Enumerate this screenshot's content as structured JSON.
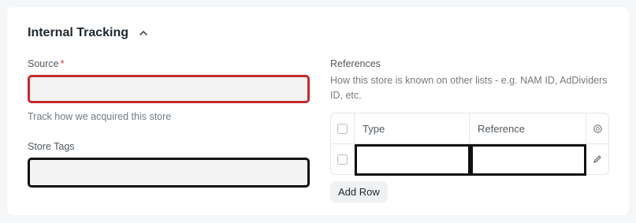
{
  "section": {
    "title": "Internal Tracking"
  },
  "source": {
    "label": "Source",
    "required_mark": "*",
    "value": "",
    "help": "Track how we acquired this store"
  },
  "store_tags": {
    "label": "Store Tags",
    "value": ""
  },
  "references": {
    "label": "References",
    "help": "How this store is known on other lists - e.g. NAM ID, AdDividers ID, etc.",
    "columns": [
      "Type",
      "Reference"
    ],
    "rows": [
      {
        "type": "",
        "reference": ""
      }
    ],
    "add_row_label": "Add Row"
  },
  "icons": {
    "collapse": "chevron-up-icon",
    "settings": "gear-icon",
    "edit": "pencil-icon"
  },
  "colors": {
    "required": "#e03131",
    "source_outline": "#c62b2b"
  }
}
